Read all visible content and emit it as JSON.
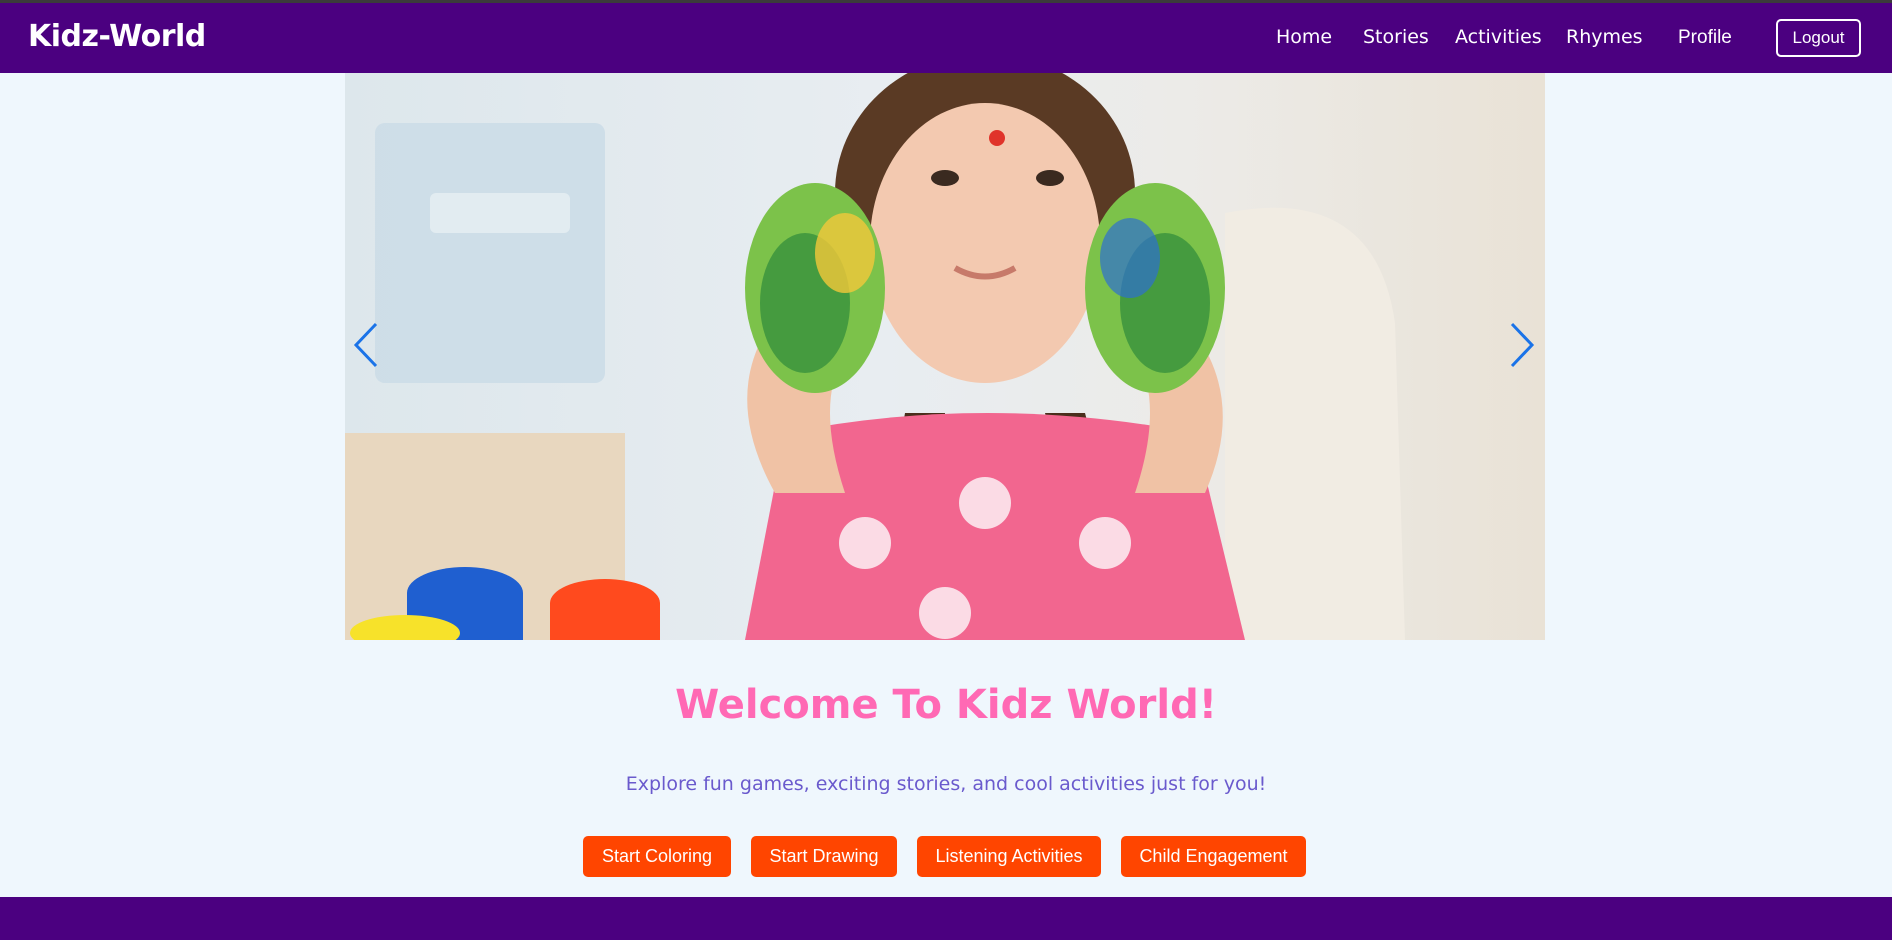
{
  "navbar": {
    "brand": "Kidz-World",
    "links": [
      "Home",
      "Stories",
      "Activities",
      "Rhymes",
      "Profile"
    ],
    "logout_label": "Logout"
  },
  "carousel": {
    "prev_icon": "chevron-left-icon",
    "next_icon": "chevron-right-icon",
    "slide_description_icon": "photo-girl-painted-hands"
  },
  "hero": {
    "title": "Welcome To Kidz World!",
    "subtitle": "Explore fun games, exciting stories, and cool activities just for you!"
  },
  "actions": [
    "Start Coloring",
    "Start Drawing",
    "Listening Activities",
    "Child Engagement"
  ],
  "colors": {
    "nav_bg": "#4b0080",
    "page_bg": "#eff7fd",
    "title": "#ff69b4",
    "subtitle": "#6a5acd",
    "button": "#ff4500",
    "arrow": "#1a73e8"
  }
}
